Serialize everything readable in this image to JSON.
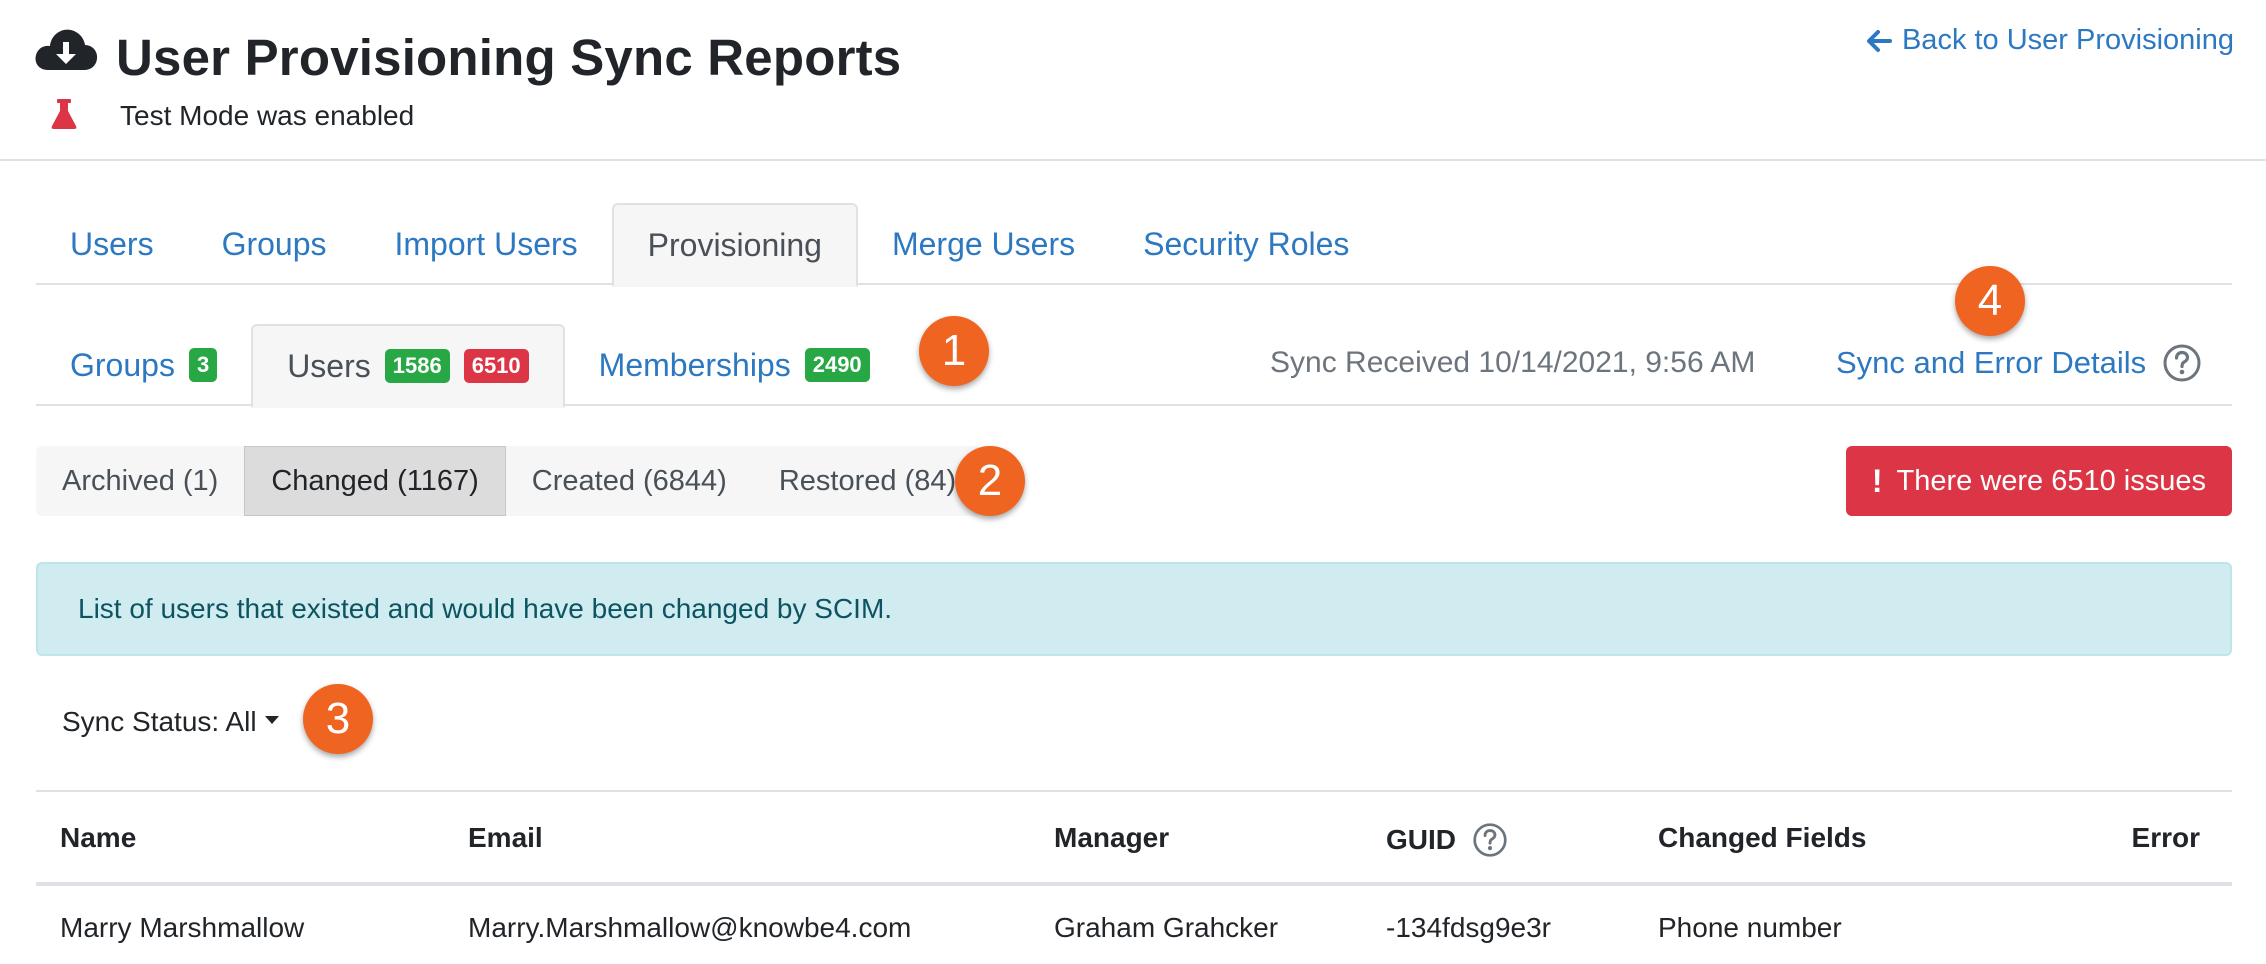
{
  "header": {
    "title": "User Provisioning Sync Reports",
    "test_mode": "Test Mode was enabled",
    "back_link": "Back to User Provisioning"
  },
  "main_tabs": [
    {
      "label": "Users",
      "active": false
    },
    {
      "label": "Groups",
      "active": false
    },
    {
      "label": "Import Users",
      "active": false
    },
    {
      "label": "Provisioning",
      "active": true
    },
    {
      "label": "Merge Users",
      "active": false
    },
    {
      "label": "Security Roles",
      "active": false
    }
  ],
  "sub_tabs": {
    "groups": {
      "label": "Groups",
      "count": "3"
    },
    "users": {
      "label": "Users",
      "count": "1586",
      "errors": "6510"
    },
    "memberships": {
      "label": "Memberships",
      "count": "2490"
    }
  },
  "sync": {
    "received": "Sync Received 10/14/2021, 9:56 AM",
    "details_link": "Sync and Error Details"
  },
  "callouts": [
    "1",
    "2",
    "3",
    "4"
  ],
  "filters": [
    {
      "label": "Archived (1)",
      "active": false
    },
    {
      "label": "Changed (1167)",
      "active": true
    },
    {
      "label": "Created (6844)",
      "active": false
    },
    {
      "label": "Restored (84)",
      "active": false
    }
  ],
  "issues_button": "There were 6510 issues",
  "alert_text": "List of users that existed and would have been changed by SCIM.",
  "sync_status": "Sync Status: All",
  "table": {
    "columns": [
      "Name",
      "Email",
      "Manager",
      "GUID",
      "Changed Fields",
      "Error"
    ],
    "rows": [
      {
        "name": "Marry Marshmallow",
        "email": "Marry.Marshmallow@knowbe4.com",
        "manager": "Graham Grahcker",
        "guid": "-134fdsg9e3r",
        "changed": "Phone number",
        "error": ""
      }
    ]
  },
  "colors": {
    "link": "#2c78c1",
    "success": "#28a745",
    "danger": "#dc3545",
    "info_bg": "#d1ecf1",
    "callout": "#ef6421"
  },
  "icons": [
    "cloud-download-icon",
    "flask-icon",
    "arrow-left-icon",
    "question-circle-icon",
    "exclamation-icon"
  ]
}
